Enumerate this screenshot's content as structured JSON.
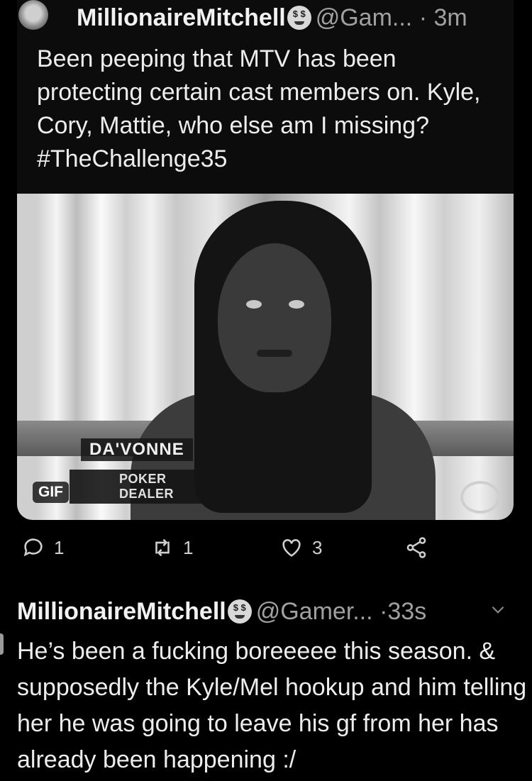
{
  "tweet1": {
    "display_name": "MillionaireMitchell",
    "handle": "@Gam...",
    "separator": "·",
    "time": "3m",
    "text": "Been peeping that MTV has been protecting certain cast members on. Kyle, Cory, Mattie, who else am I missing? #TheChallenge35",
    "media": {
      "badge": "GIF",
      "lower_third_name": "DA'VONNE",
      "lower_third_title": "POKER DEALER"
    },
    "actions": {
      "replies": "1",
      "retweets": "1",
      "likes": "3"
    }
  },
  "tweet2": {
    "display_name": "MillionaireMitchell",
    "handle": "@Gamer...",
    "separator": "·",
    "time": "33s",
    "text": "He’s been a fucking boreeeee this season. & supposedly the Kyle/Mel hookup and him telling her he was going to leave his gf from her has already been happening :/"
  },
  "icons": [
    "avatar",
    "money-face-emoji-icon",
    "reply-icon",
    "retweet-icon",
    "like-icon",
    "share-icon",
    "chevron-down-icon"
  ]
}
